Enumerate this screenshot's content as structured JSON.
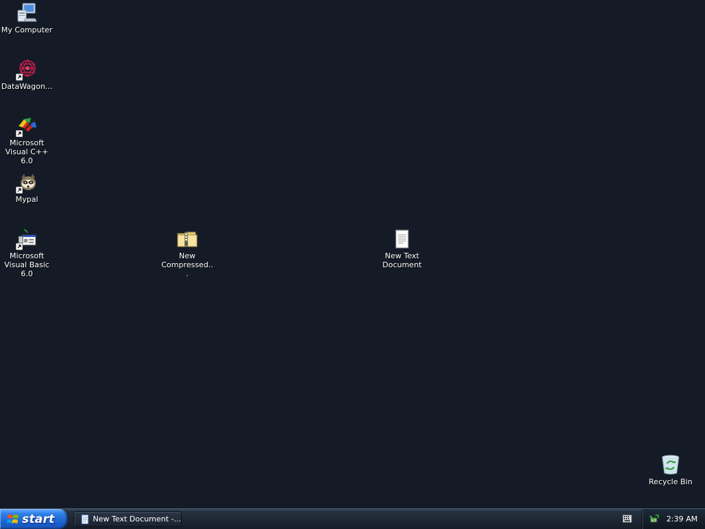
{
  "desktop": {
    "icons": [
      {
        "label": "My Computer",
        "icon": "my-computer-icon"
      },
      {
        "label": "DataWagon...",
        "icon": "datawagon-icon"
      },
      {
        "label": "Microsoft Visual C++ 6.0",
        "icon": "visual-cpp-icon"
      },
      {
        "label": "Mypal",
        "icon": "mypal-icon"
      },
      {
        "label": "Microsoft Visual Basic 6.0",
        "icon": "visual-basic-icon"
      },
      {
        "label": "New Compressed...",
        "icon": "zip-folder-icon"
      },
      {
        "label": "New Text Document",
        "icon": "text-document-icon"
      },
      {
        "label": "Recycle Bin",
        "icon": "recycle-bin-icon"
      }
    ]
  },
  "taskbar": {
    "start_label": "start",
    "task": {
      "label": "New Text Document -...",
      "icon": "notepad-icon"
    },
    "clock": "2:39 AM"
  },
  "colors": {
    "desktop_background": "#141b26",
    "start_button": "#2e7ee6"
  }
}
